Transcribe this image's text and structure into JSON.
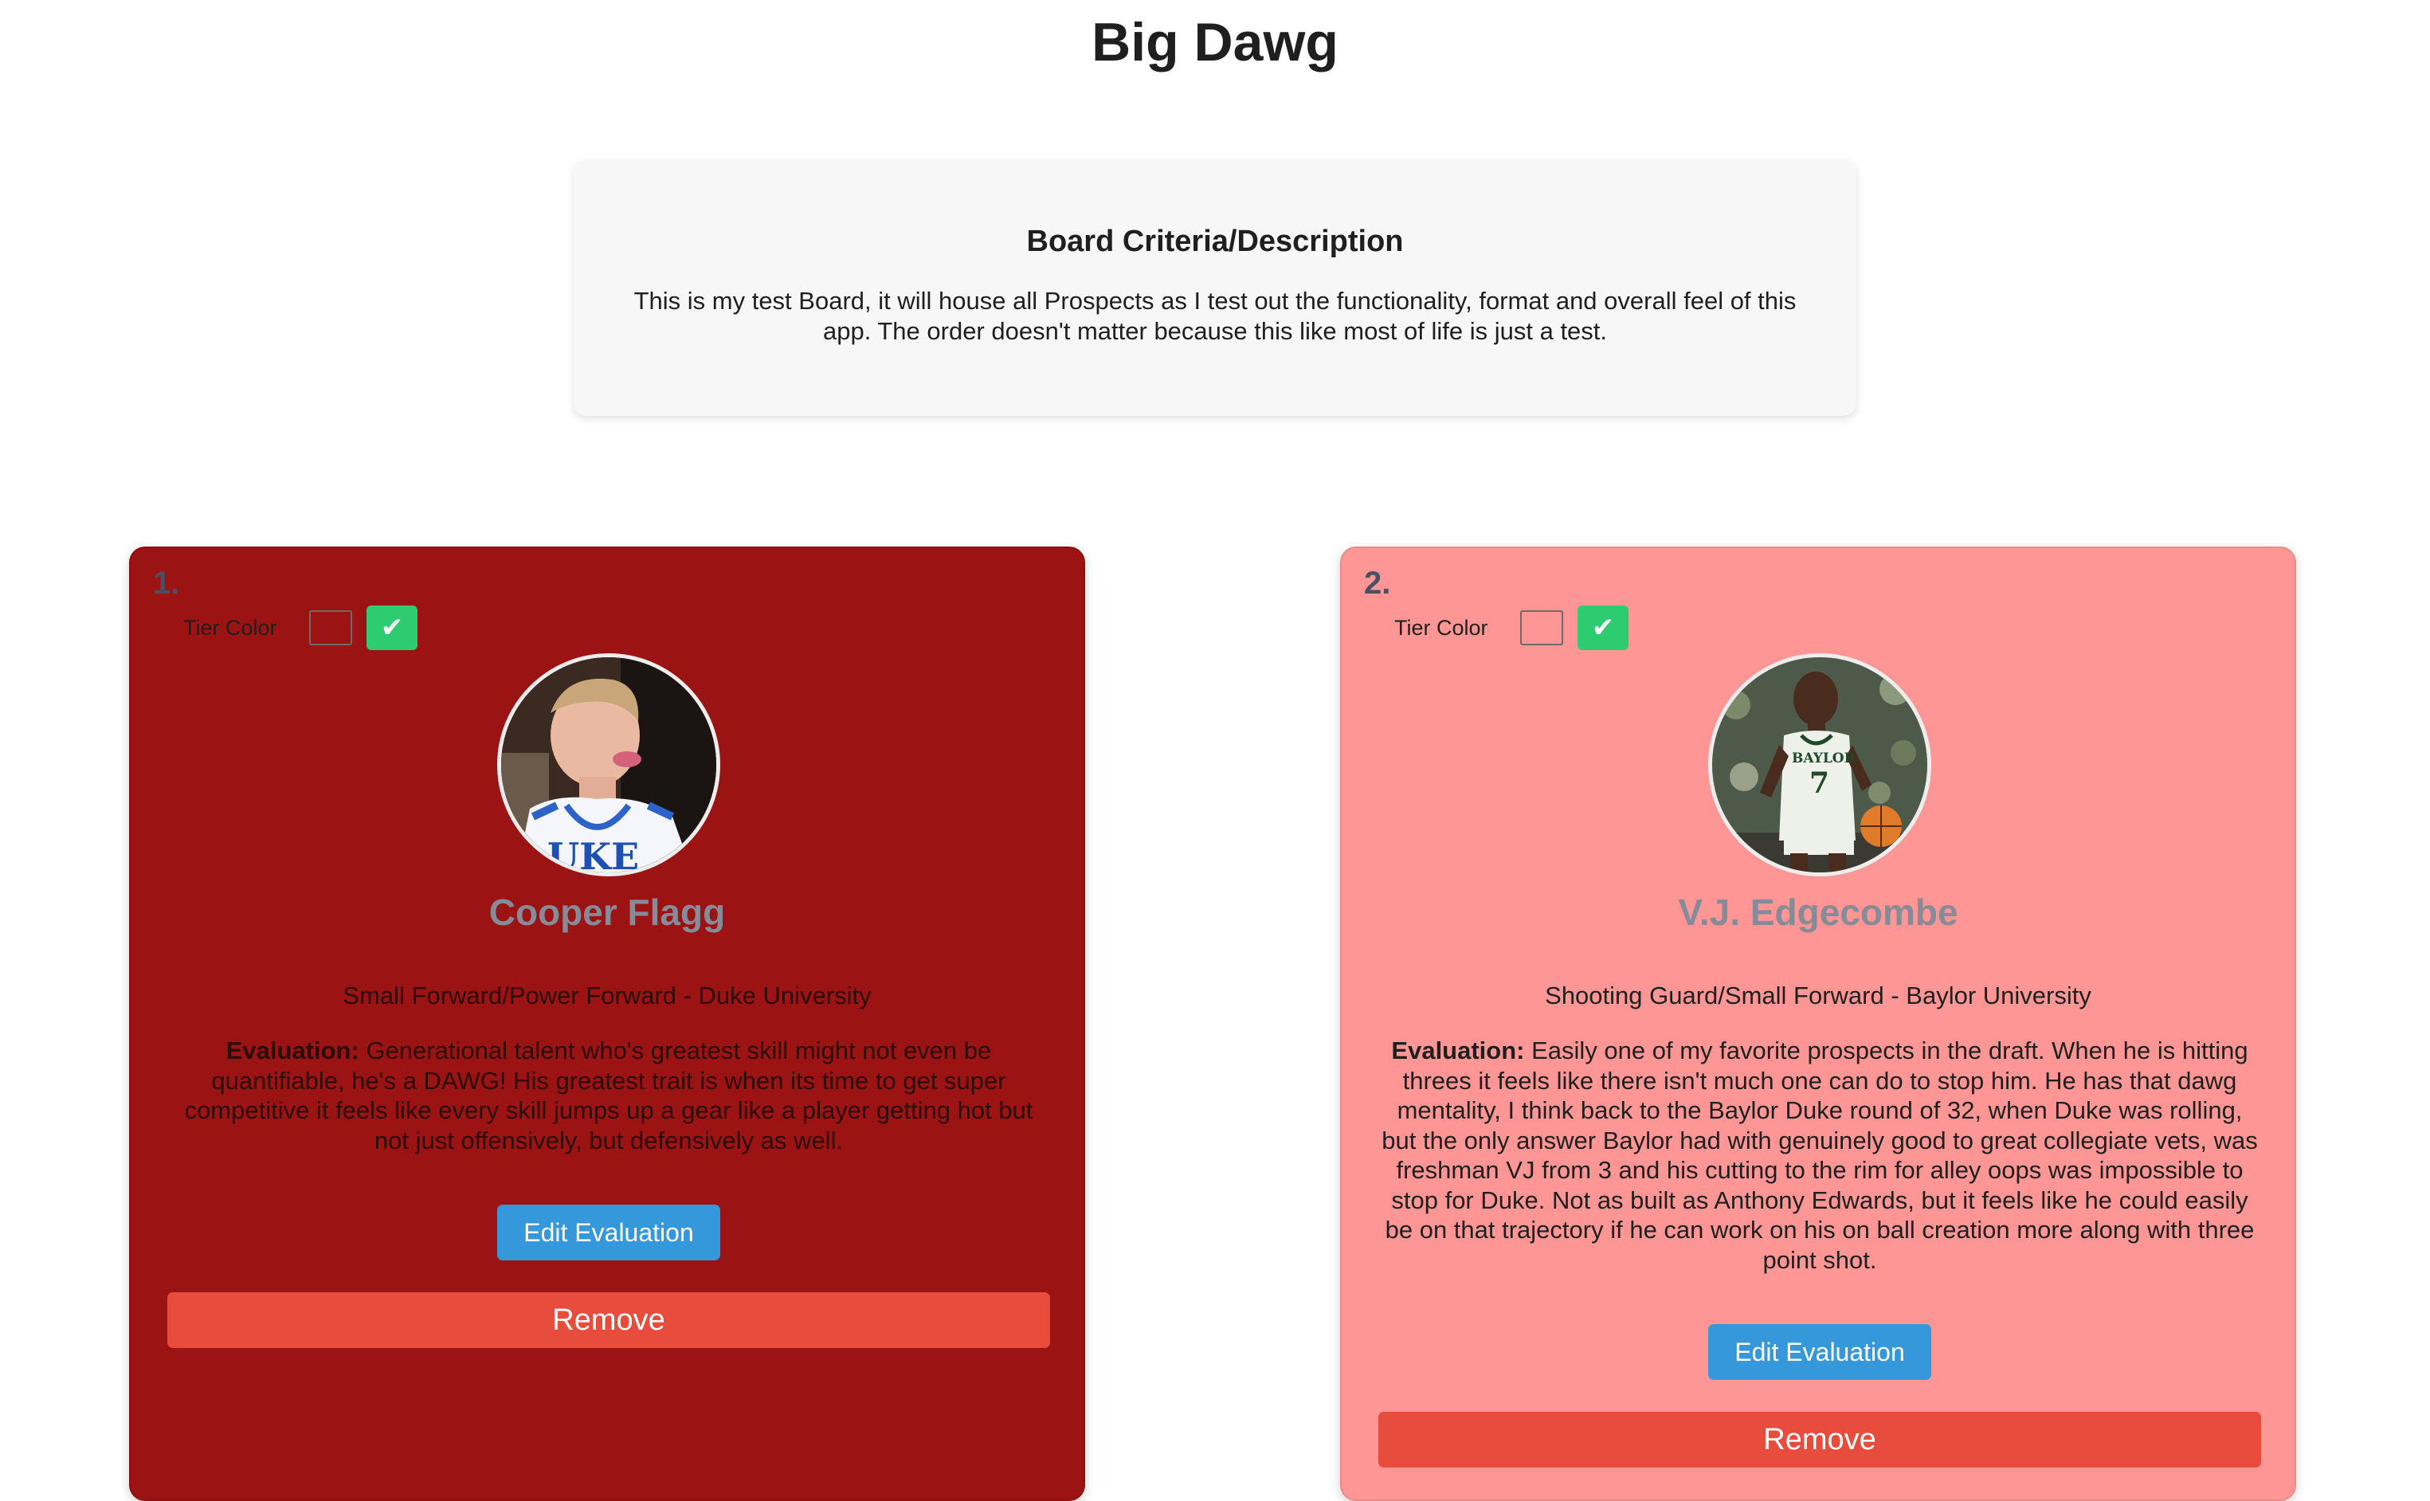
{
  "page": {
    "title": "Big Dawg"
  },
  "board": {
    "heading": "Board Criteria/Description",
    "description": "This is my test Board, it will house all Prospects as I test out the functionality, format and overall feel of this app. The order doesn't matter because this like most of life is just a test."
  },
  "colors": {
    "card_1_background": "#9b1313",
    "card_2_background": "#fd9695",
    "edit_button": "#3498db",
    "remove_button": "#e74c3c",
    "confirm_button": "#2ecc71",
    "player_name": "#858b99"
  },
  "prospects": [
    {
      "rank": "1.",
      "tier_label": "Tier Color",
      "tier_confirm": "✔",
      "name": "Cooper Flagg",
      "position": "Small Forward/Power Forward - Duke University",
      "evaluation_label": "Evaluation:",
      "evaluation_text": "Generational talent who's greatest skill might not even be quantifiable, he's a DAWG! His greatest trait is when its time to get super competitive it feels like every skill jumps up a gear like a player getting hot but not just offensively, but defensively as well.",
      "edit_label": "Edit Evaluation",
      "remove_label": "Remove",
      "jersey_text": "UKE"
    },
    {
      "rank": "2.",
      "tier_label": "Tier Color",
      "tier_confirm": "✔",
      "name": "V.J. Edgecombe",
      "position": "Shooting Guard/Small Forward - Baylor University",
      "evaluation_label": "Evaluation:",
      "evaluation_text": "Easily one of my favorite prospects in the draft. When he is hitting threes it feels like there isn't much one can do to stop him. He has that dawg mentality, I think back to the Baylor Duke round of 32, when Duke was rolling, but the only answer Baylor had with genuinely good to great collegiate vets, was freshman VJ from 3 and his cutting to the rim for alley oops was impossible to stop for Duke. Not as built as Anthony Edwards, but it feels like he could easily be on that trajectory if he can work on his on ball creation more along with three point shot.",
      "edit_label": "Edit Evaluation",
      "remove_label": "Remove",
      "jersey_text": "BAYLOR",
      "jersey_number": "7"
    }
  ]
}
